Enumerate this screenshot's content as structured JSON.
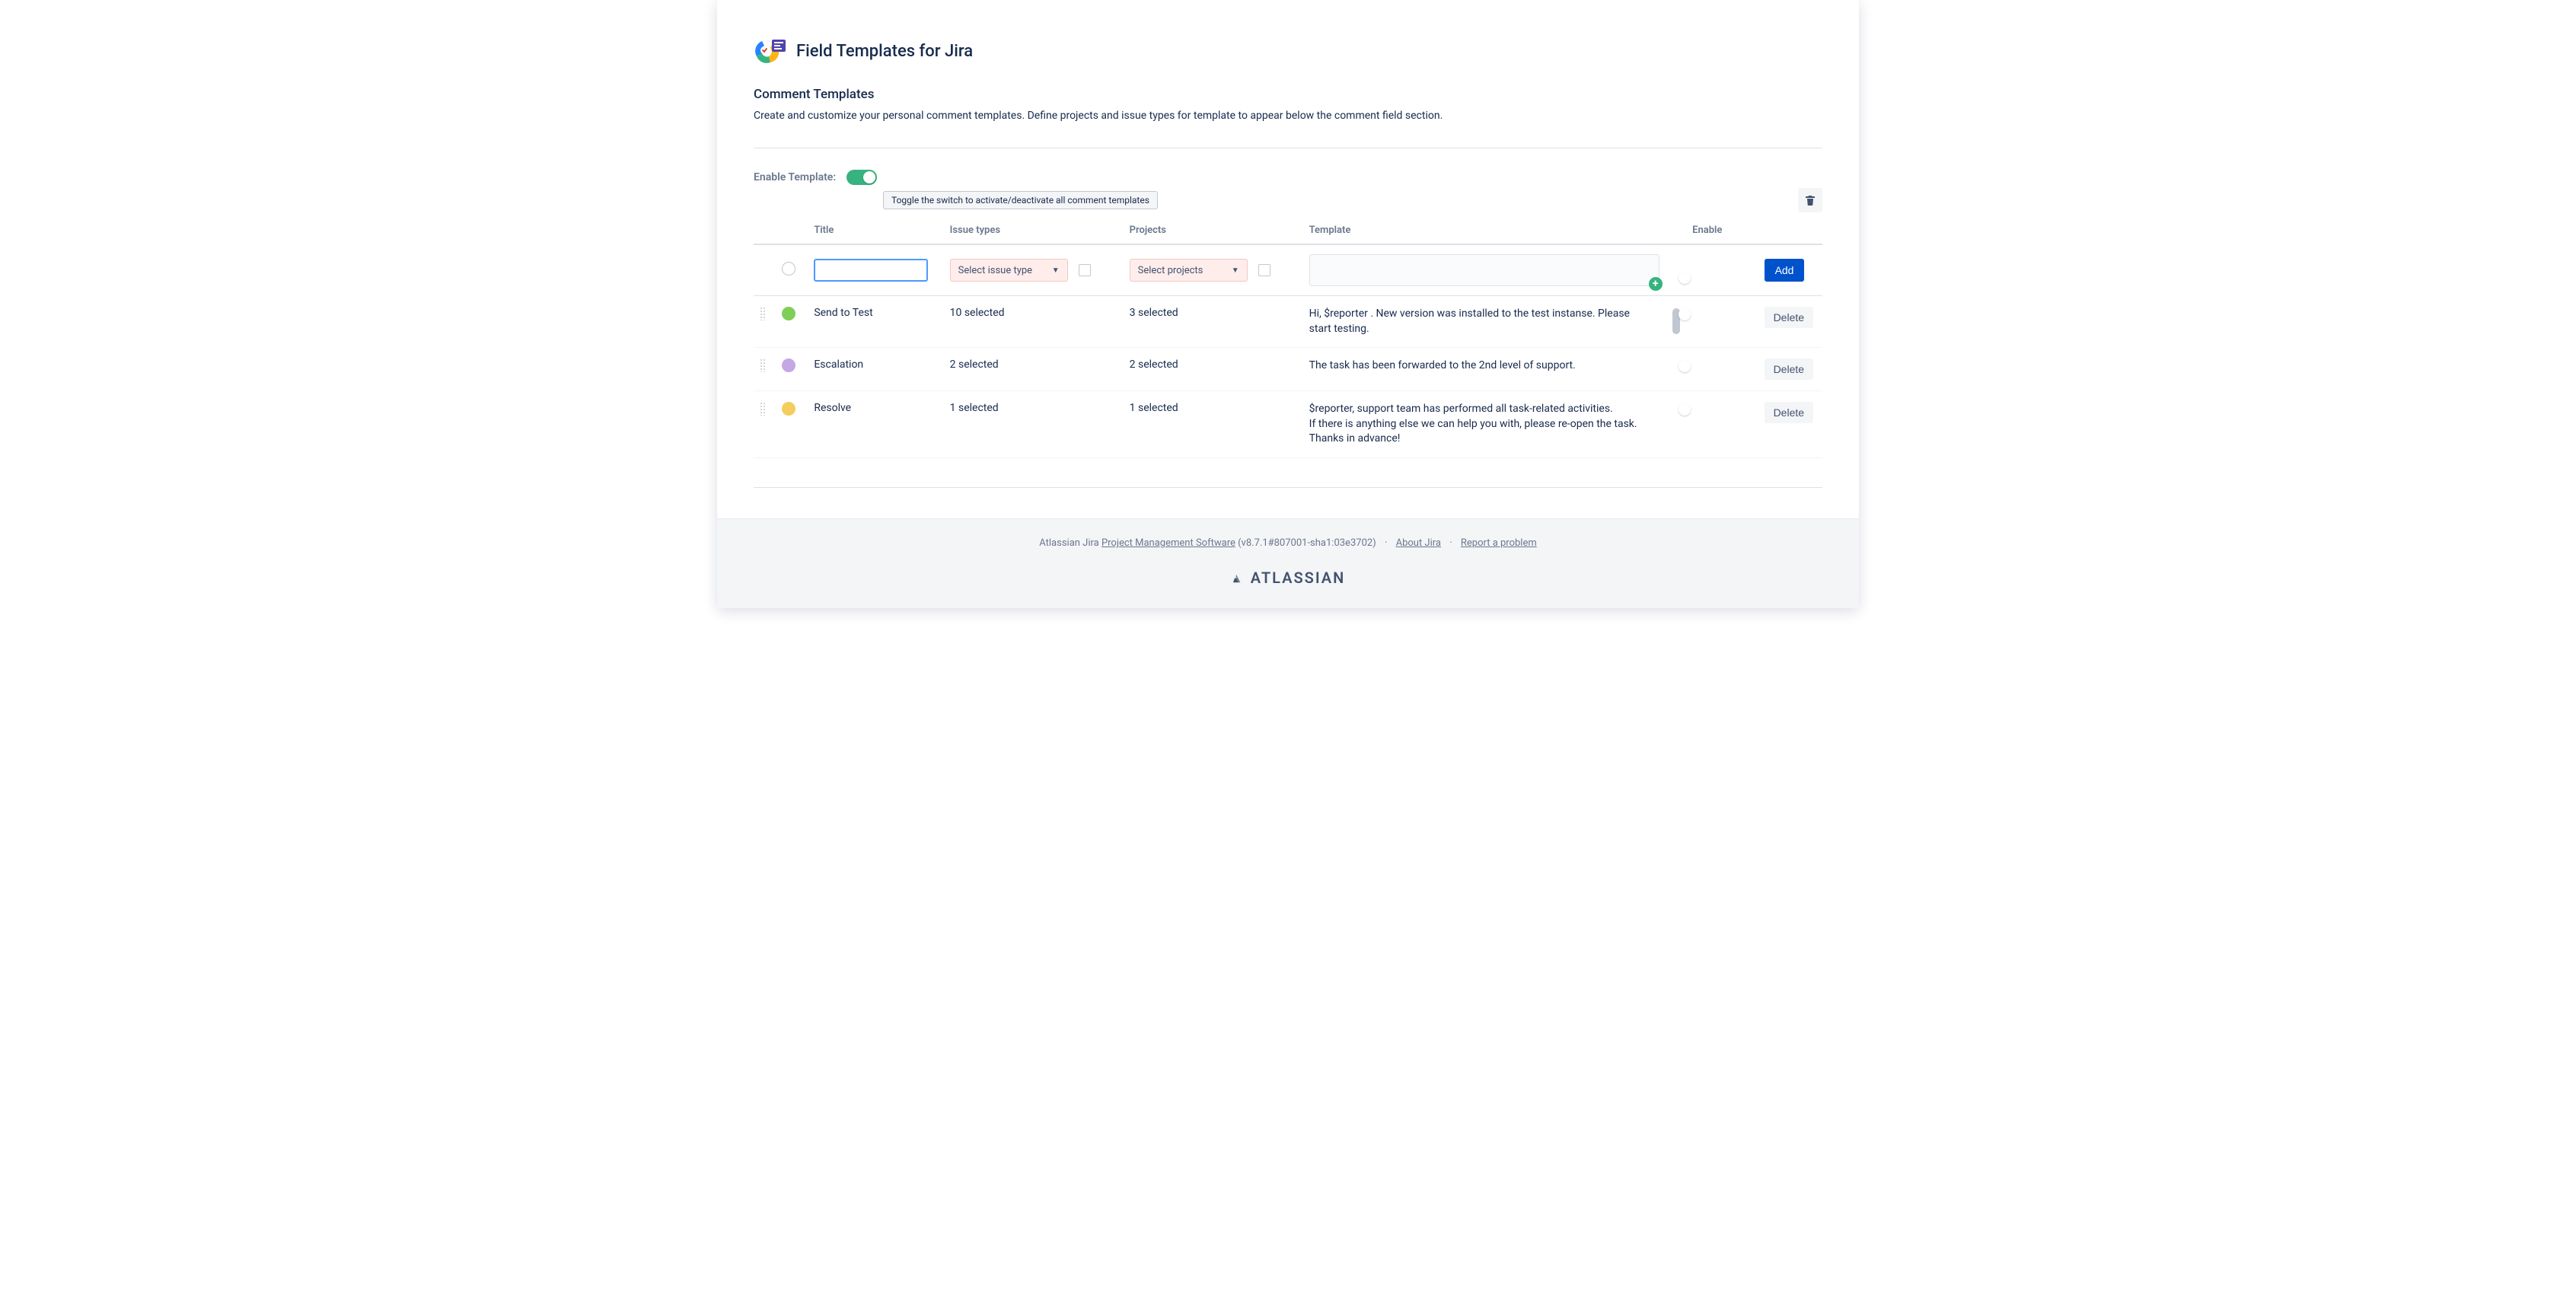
{
  "header": {
    "app_title": "Field Templates for Jira"
  },
  "section": {
    "title": "Comment Templates",
    "description": "Create and customize your personal comment templates. Define projects and issue types for template to appear below the comment field section."
  },
  "enable_template": {
    "label": "Enable Template:",
    "tooltip": "Toggle the switch to activate/deactivate all comment templates",
    "enabled": true
  },
  "columns": {
    "title": "Title",
    "issue_types": "Issue types",
    "projects": "Projects",
    "template": "Template",
    "enable": "Enable"
  },
  "input_row": {
    "issue_type_placeholder": "Select issue type",
    "projects_placeholder": "Select projects",
    "add_label": "Add"
  },
  "rows": [
    {
      "color": "#7fce58",
      "title": "Send to Test",
      "issue_types": "10 selected",
      "projects": "3 selected",
      "template": "Hi,  $reporter . New version was installed to the test instanse. Please start testing.",
      "enabled": true,
      "show_scroll": true,
      "delete_label": "Delete"
    },
    {
      "color": "#c5a7e6",
      "title": "Escalation",
      "issue_types": "2 selected",
      "projects": "2 selected",
      "template": "The task has been forwarded to the 2nd level of support.",
      "enabled": true,
      "show_scroll": false,
      "delete_label": "Delete"
    },
    {
      "color": "#f3cd5d",
      "title": "Resolve",
      "issue_types": "1 selected",
      "projects": "1 selected",
      "template": "$reporter, support team has performed all task-related activities.\nIf there is anything else we can help you with, please re-open the task.\nThanks in advance!",
      "enabled": true,
      "show_scroll": false,
      "delete_label": "Delete"
    }
  ],
  "footer": {
    "prefix": "Atlassian Jira ",
    "link1": "Project Management Software",
    "version": " (v8.7.1#807001-sha1:03e3702)",
    "link2": "About Jira",
    "link3": "Report a problem",
    "brand": "ATLASSIAN"
  }
}
